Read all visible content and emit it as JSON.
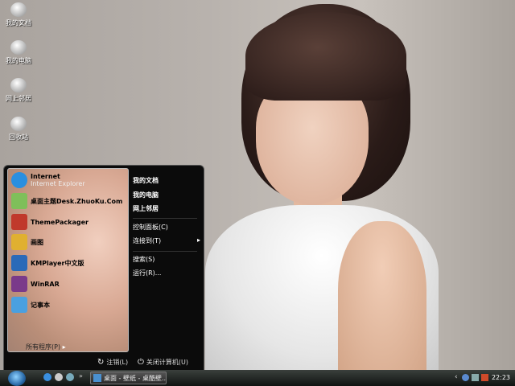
{
  "desktop": {
    "icons": [
      {
        "label": "我的文档",
        "icon": "documents-icon"
      },
      {
        "label": "我的电脑",
        "icon": "computer-icon"
      },
      {
        "label": "网上邻居",
        "icon": "network-icon"
      },
      {
        "label": "回收站",
        "icon": "recycle-bin-icon"
      }
    ]
  },
  "start_menu": {
    "pinned": [
      {
        "title": "Internet",
        "subtitle": "Internet Explorer",
        "icon": "ie-icon",
        "color": "#2a8fe0"
      }
    ],
    "programs": [
      {
        "label": "桌面主题Desk.ZhuoKu.Com",
        "icon": "theme-icon",
        "color": "#7fbf5a"
      },
      {
        "label": "ThemePackager",
        "icon": "packager-icon",
        "color": "#c0392b"
      },
      {
        "label": "画图",
        "icon": "paint-icon",
        "color": "#e0b030"
      },
      {
        "label": "KMPlayer中文版",
        "icon": "kmplayer-icon",
        "color": "#2a6ab8"
      },
      {
        "label": "WinRAR",
        "icon": "winrar-icon",
        "color": "#7a3a8a"
      },
      {
        "label": "记事本",
        "icon": "notepad-icon",
        "color": "#4aa0e0"
      }
    ],
    "all_programs": "所有程序(P)",
    "right": [
      {
        "label": "我的文档"
      },
      {
        "label": "我的电脑"
      },
      {
        "label": "网上邻居"
      },
      {
        "label": "控制面板(C)"
      },
      {
        "label": "连接到(T)",
        "arrow": "▸"
      },
      {
        "label": "搜索(S)"
      },
      {
        "label": "运行(R)..."
      }
    ],
    "logoff": "注销(L)",
    "shutdown": "关闭计算机(U)"
  },
  "taskbar": {
    "task_label": "桌面 - 壁纸 - 桌酷壁...",
    "more": "»",
    "clock": "22:23",
    "expand": "‹"
  }
}
